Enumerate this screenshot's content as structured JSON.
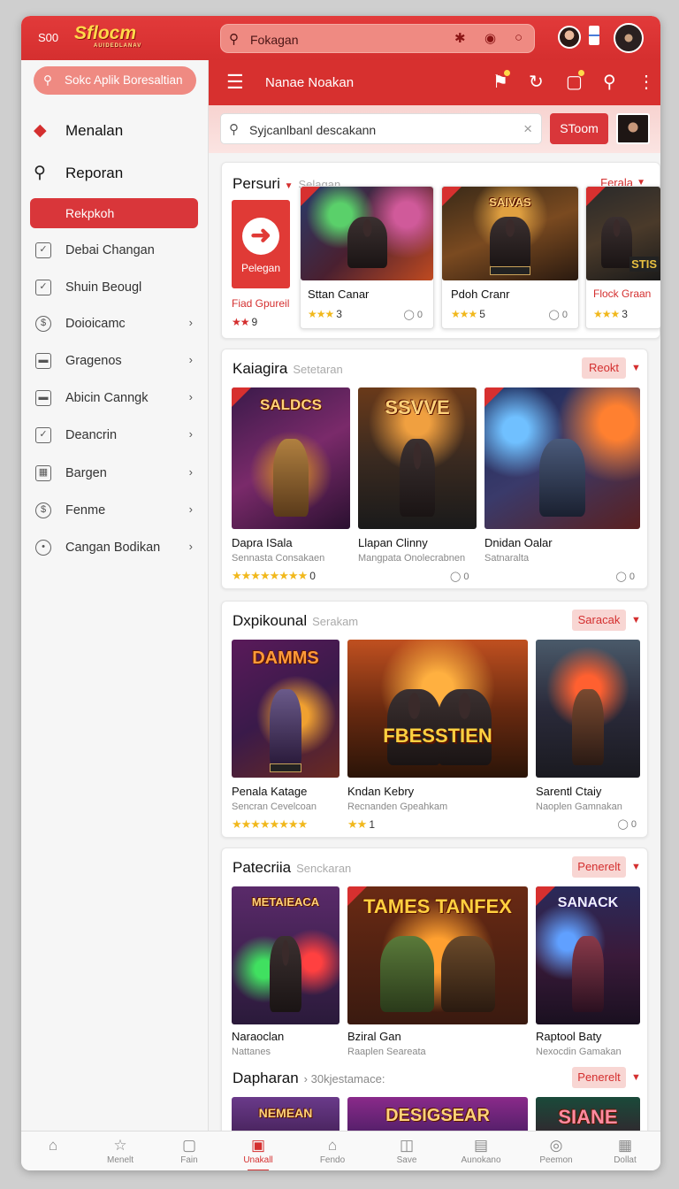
{
  "topbar": {
    "badge": "S00",
    "logo": "Sflocm",
    "logo_sub": "AUIDEDLANAV",
    "search": "Fokagan"
  },
  "sidebar": {
    "search": "Sokc Aplik Boresaltian",
    "headers": [
      "Menalan",
      "Reporan"
    ],
    "active": "Rekpkoh",
    "items": [
      {
        "label": "Debai Changan",
        "chevron": false
      },
      {
        "label": "Shuin Beougl",
        "chevron": false
      },
      {
        "label": "Doioicamc",
        "chevron": true
      },
      {
        "label": "Gragenos",
        "chevron": true
      },
      {
        "label": "Abicin Canngk",
        "chevron": true
      },
      {
        "label": "Deancrin",
        "chevron": true
      },
      {
        "label": "Bargen",
        "chevron": true
      },
      {
        "label": "Fenme",
        "chevron": true
      },
      {
        "label": "Cangan Bodikan",
        "chevron": true
      }
    ]
  },
  "appbar": {
    "title": "Nanae Noakan"
  },
  "search": {
    "placeholder": "Syjcanlbanl descakann",
    "button": "SToom"
  },
  "sections": [
    {
      "title": "Persuri",
      "subtitle": "Selagan",
      "action": "Ferala",
      "feature": {
        "icon_label": "Pelegan",
        "name": "Fiad Gpureil",
        "rating": "9"
      },
      "cards": [
        {
          "name": "Sttan Canar",
          "sub": "",
          "stars": "★★★",
          "rating": "3",
          "comments": "0"
        },
        {
          "name": "Pdoh Cranr",
          "sub": "",
          "stars": "★★★",
          "rating": "5",
          "comments": "0",
          "art_title": "SAIVAS"
        },
        {
          "name": "Flock Graan",
          "sub": "",
          "stars": "★★★",
          "rating": "3",
          "comments": "",
          "art_title": "STIS"
        }
      ]
    },
    {
      "title": "Kaiagira",
      "subtitle": "Setetaran",
      "action": "Reokt",
      "cards": [
        {
          "name": "Dapra ISala",
          "sub": "Sennasta Consakaen",
          "stars": "★★★★★★★★",
          "rating": "0",
          "comments": "",
          "art_title": "SALDCS"
        },
        {
          "name": "Llapan Clinny",
          "sub": "Mangpata Onolecrabnen",
          "stars": "",
          "rating": "",
          "comments": "0",
          "art_title": "SSVVE"
        },
        {
          "name": "Dnidan Oalar",
          "sub": "Satnaralta",
          "stars": "",
          "rating": "",
          "comments": "0",
          "art_title": ""
        }
      ]
    },
    {
      "title": "Dxpikounal",
      "subtitle": "Serakam",
      "action": "Saracak",
      "cards": [
        {
          "name": "Penala Katage",
          "sub": "Sencran Cevelcoan",
          "stars": "★★★★★★★★",
          "rating": "",
          "comments": "",
          "art_title": "DAMMS"
        },
        {
          "name": "Kndan Kebry",
          "sub": "Recnanden Gpeahkam",
          "stars": "★★",
          "rating": "1",
          "comments": "",
          "art_title": "FBESSTIEN"
        },
        {
          "name": "Sarentl Ctaiy",
          "sub": "Naoplen Gamnakan",
          "stars": "",
          "rating": "",
          "comments": "0",
          "art_title": ""
        }
      ]
    },
    {
      "title": "Patecriia",
      "subtitle": "Senckaran",
      "action": "Penerelt",
      "cards": [
        {
          "name": "Naraoclan",
          "sub": "Nattanes",
          "art_title": "METAIEACA"
        },
        {
          "name": "Bziral Gan",
          "sub": "Raaplen Seareata",
          "art_title": "TAMES TANFEX"
        },
        {
          "name": "Raptool Baty",
          "sub": "Nexocdin Gamakan",
          "art_title": "SANACK"
        }
      ]
    },
    {
      "title": "Dapharan",
      "subtitle": "30kjestamace:",
      "action": "Penerelt",
      "cards": [
        {
          "art_title": "NEMEAN"
        },
        {
          "art_title": "DESIGSEAR"
        },
        {
          "art_title": "SIANE"
        }
      ]
    }
  ],
  "bottom_nav": [
    {
      "label": "",
      "icon": "home-icon"
    },
    {
      "label": "Menelt",
      "icon": "star-icon"
    },
    {
      "label": "Fain",
      "icon": "square-icon"
    },
    {
      "label": "Unakall",
      "icon": "box-icon",
      "active": true
    },
    {
      "label": "Fendo",
      "icon": "home-icon"
    },
    {
      "label": "Save",
      "icon": "gift-icon"
    },
    {
      "label": "Aunokano",
      "icon": "doc-icon"
    },
    {
      "label": "Peemon",
      "icon": "globe-icon"
    },
    {
      "label": "Dollat",
      "icon": "grid-icon"
    }
  ]
}
